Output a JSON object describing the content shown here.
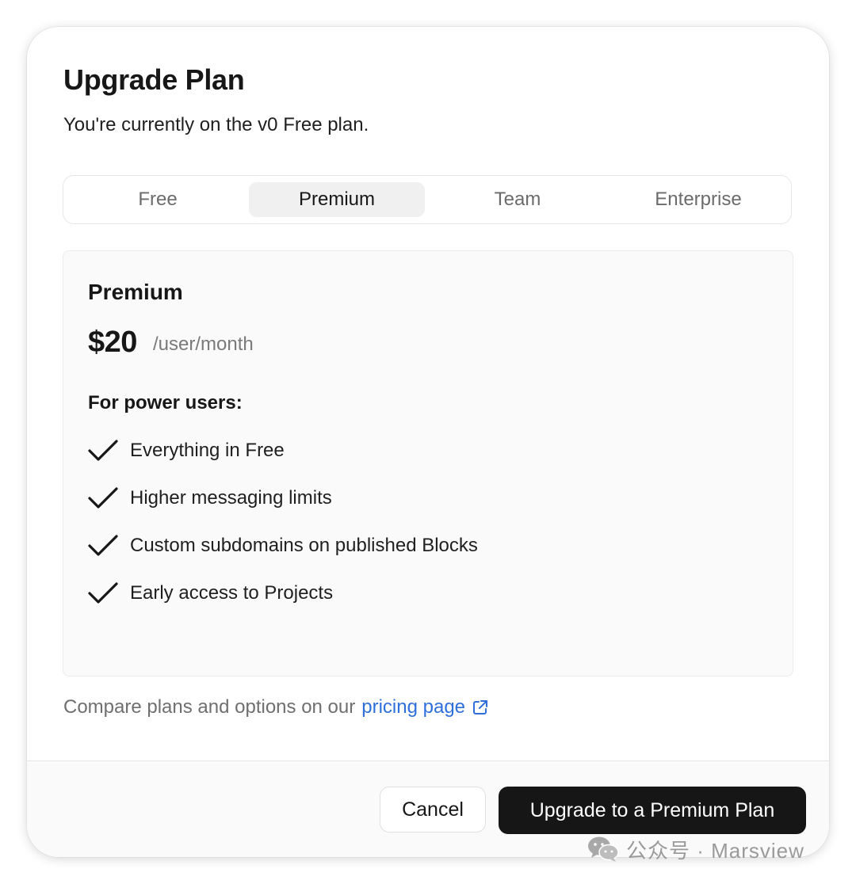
{
  "dialog": {
    "title": "Upgrade Plan",
    "subtitle": "You're currently on the v0 Free plan."
  },
  "tabs": [
    {
      "label": "Free",
      "active": false
    },
    {
      "label": "Premium",
      "active": true
    },
    {
      "label": "Team",
      "active": false
    },
    {
      "label": "Enterprise",
      "active": false
    }
  ],
  "plan": {
    "name": "Premium",
    "price": "$20",
    "price_unit": "/user/month",
    "features_heading": "For power users:",
    "features": [
      "Everything in Free",
      "Higher messaging limits",
      "Custom subdomains on published Blocks",
      "Early access to Projects"
    ]
  },
  "compare": {
    "text": "Compare plans and options on our",
    "link_label": "pricing page",
    "link_icon": "external-link-icon"
  },
  "footer": {
    "cancel_label": "Cancel",
    "upgrade_label": "Upgrade to a Premium Plan"
  },
  "watermark": {
    "text": "公众号 · Marsview",
    "icon": "wechat-icon"
  },
  "colors": {
    "link": "#2f6fdc",
    "primary_button": "#161616",
    "card_background": "#fafafa",
    "active_tab": "#f0f0f0"
  }
}
